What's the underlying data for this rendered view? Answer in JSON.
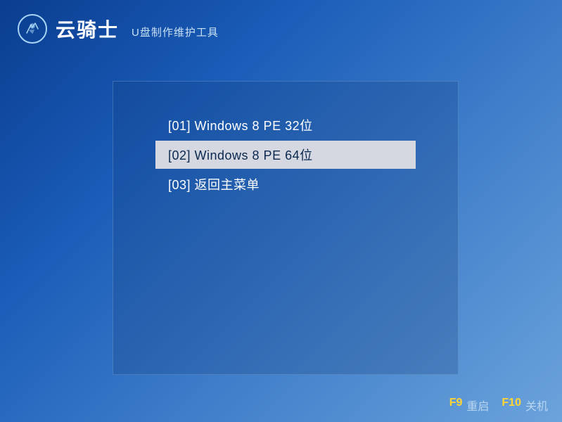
{
  "header": {
    "brand": "云骑士",
    "subtitle": "U盘制作维护工具"
  },
  "menu": {
    "items": [
      {
        "label": "[01] Windows 8 PE 32位",
        "selected": false
      },
      {
        "label": "[02] Windows 8 PE 64位",
        "selected": true
      },
      {
        "label": "[03] 返回主菜单",
        "selected": false
      }
    ]
  },
  "footer": {
    "restart": {
      "key": "F9",
      "label": "重启"
    },
    "shutdown": {
      "key": "F10",
      "label": "关机"
    }
  }
}
